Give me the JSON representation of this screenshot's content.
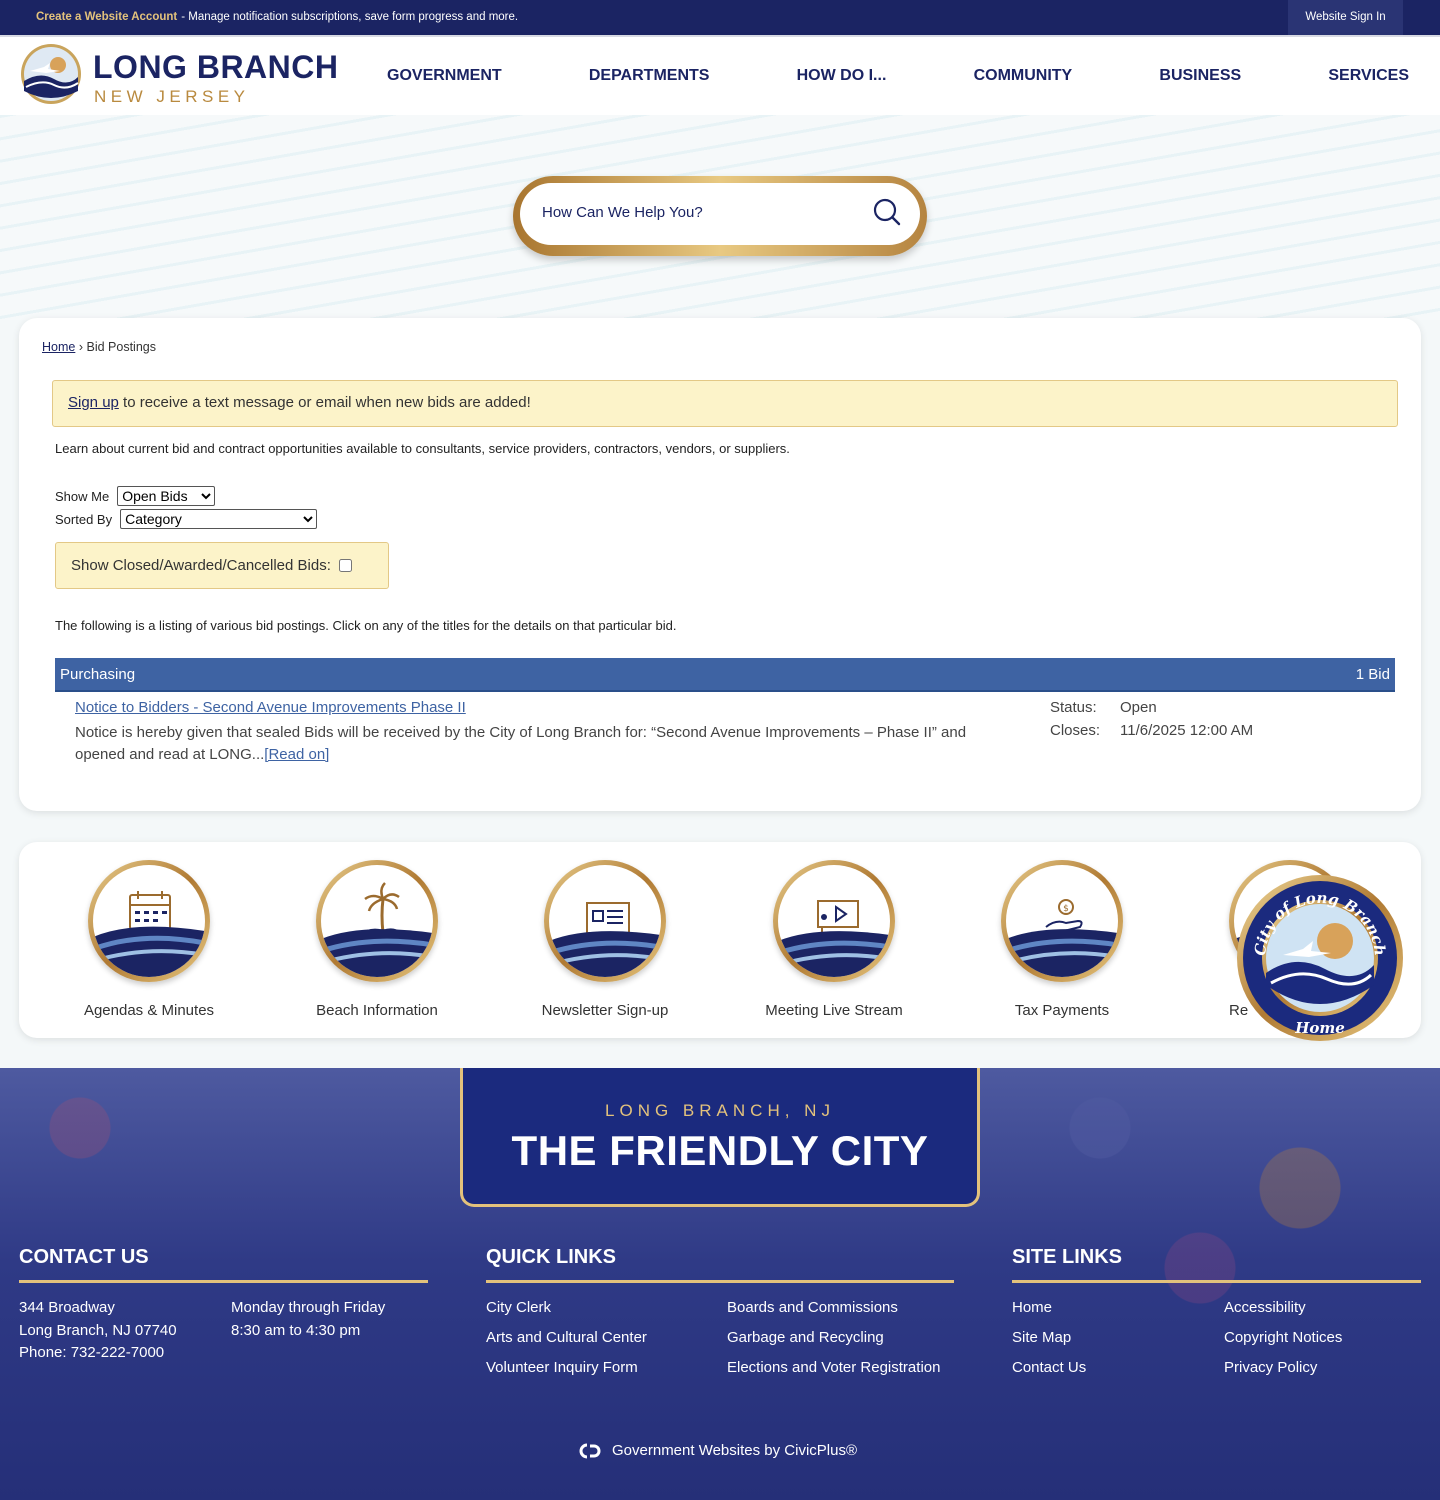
{
  "topbar": {
    "create_link": "Create a Website Account",
    "create_text": "- Manage notification subscriptions, save form progress and more.",
    "signin": "Website Sign In"
  },
  "logo": {
    "name": "LONG BRANCH",
    "state": "NEW JERSEY"
  },
  "nav": [
    "GOVERNMENT",
    "DEPARTMENTS",
    "HOW DO I...",
    "COMMUNITY",
    "BUSINESS",
    "SERVICES"
  ],
  "search": {
    "placeholder": "How Can We Help You?"
  },
  "breadcrumb": {
    "home": "Home",
    "sep": "›",
    "current": "Bid Postings"
  },
  "alert": {
    "link": "Sign up",
    "text": " to receive a text message or email when new bids are added!"
  },
  "intro": "Learn about current bid and contract opportunities available to consultants, service providers, contractors, vendors, or suppliers.",
  "filters": {
    "show_me_label": "Show Me",
    "show_me_value": "Open Bids",
    "sorted_by_label": "Sorted By",
    "sorted_by_value": "Category",
    "closed_label": "Show Closed/Awarded/Cancelled Bids:"
  },
  "listing_text": "The following is a listing of various bid postings. Click on any of the titles for the details on that particular bid.",
  "category": {
    "name": "Purchasing",
    "count": "1 Bid"
  },
  "bid": {
    "title": "Notice to Bidders - Second Avenue Improvements Phase II",
    "desc": "Notice is hereby given that sealed Bids will be received by the City of Long Branch for: “Second Avenue Improvements – Phase II” and opened and read at LONG...",
    "read_on": "[Read on]",
    "status_label": "Status:",
    "status_value": "Open",
    "closes_label": "Closes:",
    "closes_value": "11/6/2025 12:00 AM"
  },
  "quick_icons": [
    {
      "label": "Agendas & Minutes",
      "icon": "calendar-icon"
    },
    {
      "label": "Beach Information",
      "icon": "palm-tree-icon"
    },
    {
      "label": "Newsletter Sign-up",
      "icon": "newsletter-icon"
    },
    {
      "label": "Meeting Live Stream",
      "icon": "presentation-icon"
    },
    {
      "label": "Tax Payments",
      "icon": "hand-dollar-icon"
    },
    {
      "label": "Re",
      "icon": "report-icon"
    }
  ],
  "home_seal": {
    "ring_text": "City of Long Branch",
    "label": "Home"
  },
  "footer": {
    "tag_small": "LONG BRANCH, NJ",
    "tag_big": "THE FRIENDLY CITY",
    "contact": {
      "title": "CONTACT US",
      "addr1": "344 Broadway",
      "addr2": "Long Branch, NJ 07740",
      "phone": "Phone: 732-222-7000",
      "hours1": "Monday through Friday",
      "hours2": "8:30 am to 4:30 pm"
    },
    "quick_links": {
      "title": "QUICK LINKS",
      "col1": [
        "City Clerk",
        "Arts and Cultural Center",
        "Volunteer Inquiry Form"
      ],
      "col2": [
        "Boards and Commissions",
        "Garbage and Recycling",
        "Elections and Voter Registration"
      ]
    },
    "site_links": {
      "title": "SITE LINKS",
      "col1": [
        "Home",
        "Site Map",
        "Contact Us"
      ],
      "col2": [
        "Accessibility",
        "Copyright Notices",
        "Privacy Policy"
      ]
    },
    "civic": "Government Websites by CivicPlus®"
  },
  "colors": {
    "navy": "#1b2463",
    "gold": "#e3c27c",
    "bar_blue": "#3e63a3",
    "alert_bg": "#fcf3c9"
  }
}
